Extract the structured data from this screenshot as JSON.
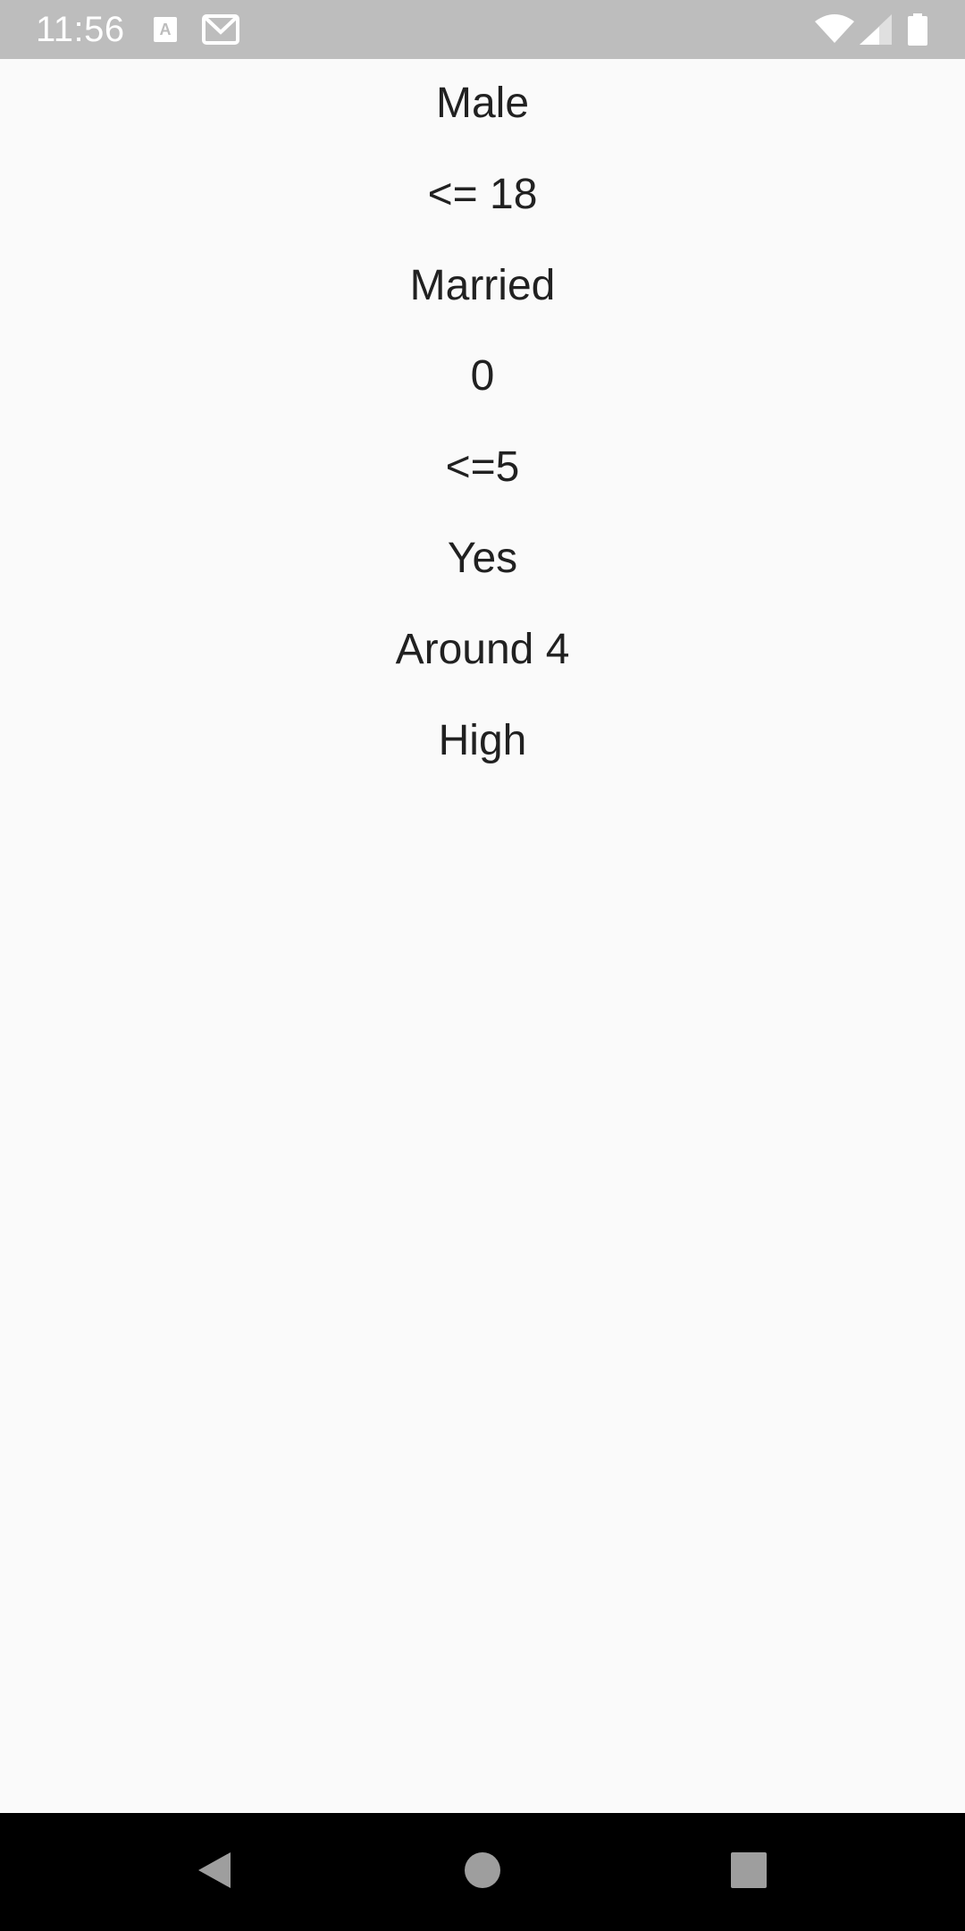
{
  "status_bar": {
    "time": "11:56",
    "icons": [
      "a-icon",
      "gmail-icon",
      "wifi-icon",
      "cellular-signal-icon",
      "battery-icon"
    ]
  },
  "content": {
    "values": [
      "Male",
      "<= 18",
      "Married",
      "0",
      "<=5",
      "Yes",
      "Around 4",
      "High"
    ]
  },
  "nav_bar": {
    "buttons": [
      "back-icon",
      "home-icon",
      "recents-icon"
    ]
  },
  "colors": {
    "status_bar_bg": "#bdbdbd",
    "page_bg": "#fafafa",
    "text": "#212121",
    "nav_bar_bg": "#000000",
    "nav_icon": "#9e9e9e"
  }
}
